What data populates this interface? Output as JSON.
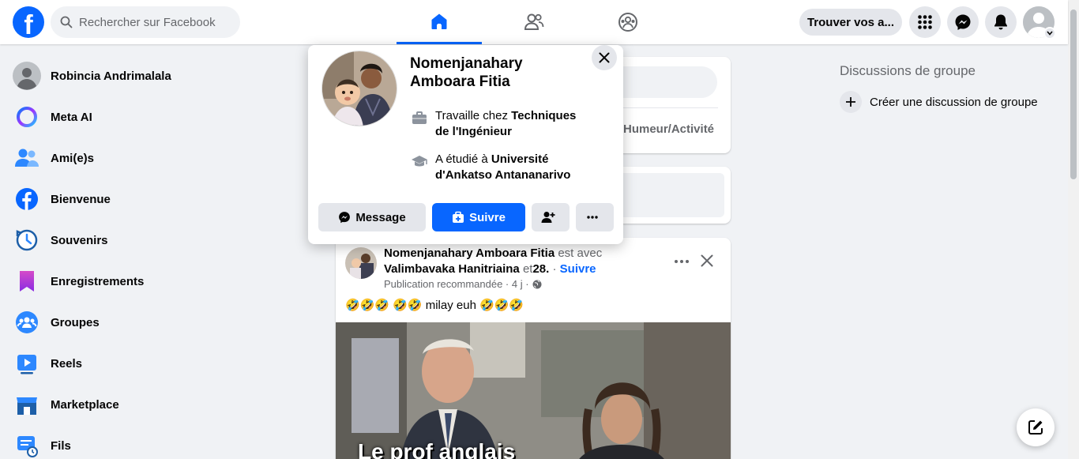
{
  "colors": {
    "accent": "#0866ff",
    "background": "#f0f2f5",
    "muted": "#65676b"
  },
  "header": {
    "logo_letter": "f",
    "search": {
      "placeholder": "Rechercher sur Facebook"
    },
    "nav_tabs": [
      {
        "icon": "home-icon",
        "active": true
      },
      {
        "icon": "friends-icon",
        "active": false
      },
      {
        "icon": "groups-icon",
        "active": false
      }
    ],
    "find_friends_label": "Trouver vos a...",
    "icons": [
      "menu-grid-icon",
      "messenger-icon",
      "bell-icon",
      "account-avatar-icon"
    ]
  },
  "sidebar": {
    "items": [
      {
        "label": "Robincia Andrimalala",
        "icon": "profile-avatar-icon"
      },
      {
        "label": "Meta AI",
        "icon": "meta-ai-icon"
      },
      {
        "label": "Ami(e)s",
        "icon": "friends-icon"
      },
      {
        "label": "Bienvenue",
        "icon": "facebook-icon"
      },
      {
        "label": "Souvenirs",
        "icon": "memories-clock-icon"
      },
      {
        "label": "Enregistrements",
        "icon": "bookmark-icon"
      },
      {
        "label": "Groupes",
        "icon": "groups-icon"
      },
      {
        "label": "Reels",
        "icon": "reels-icon"
      },
      {
        "label": "Marketplace",
        "icon": "marketplace-icon"
      },
      {
        "label": "Fils",
        "icon": "feeds-icon"
      }
    ]
  },
  "composer": {
    "feeling_label": "Humeur/Activité"
  },
  "post": {
    "author": "Nomenjanahary Amboara Fitia",
    "with_text": "est avec",
    "tagged": "Valimbavaka Hanitriaina",
    "and_text": "et",
    "others": "28",
    "follow_label": "Suivre",
    "meta": "Publication recommandée · 4 j ·",
    "text": "🤣🤣🤣 🤣🤣 milay euh 🤣🤣🤣",
    "image_caption": "Le prof anglais"
  },
  "right": {
    "title": "Discussions de groupe",
    "create_label": "Créer une discussion de groupe"
  },
  "hovercard": {
    "name": "Nomenjanahary Amboara Fitia",
    "work_prefix": "Travaille chez",
    "work_place": "Techniques de l'Ingénieur",
    "study_prefix": "A étudié à",
    "study_place": "Université d'Ankatso Antananarivo",
    "message_label": "Message",
    "follow_label": "Suivre"
  }
}
